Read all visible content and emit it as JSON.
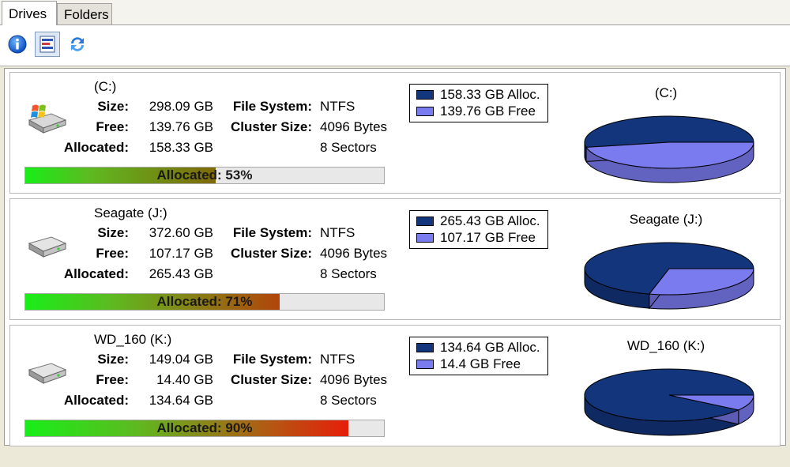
{
  "tabs": [
    {
      "label": "Drives",
      "active": true
    },
    {
      "label": "Folders",
      "active": false
    }
  ],
  "toolbar": {
    "buttons": [
      {
        "icon": "info-icon"
      },
      {
        "icon": "details-view-icon",
        "pressed": true
      },
      {
        "icon": "refresh-icon"
      }
    ]
  },
  "labels": {
    "size": "Size:",
    "free": "Free:",
    "allocated": "Allocated:",
    "file_system": "File System:",
    "cluster_size": "Cluster Size:"
  },
  "colors": {
    "allocated": "#13357b",
    "free": "#7b7bf0"
  },
  "drives": [
    {
      "name": "(C:)",
      "icon": "windows-drive-icon",
      "size": "298.09 GB",
      "free": "139.76 GB",
      "allocated": "158.33 GB",
      "file_system": "NTFS",
      "cluster_size": "4096 Bytes",
      "sectors": "8 Sectors",
      "allocated_pct": 53,
      "bar_label": "Allocated: 53%",
      "legend_alloc": "158.33 GB Alloc.",
      "legend_free": "139.76 GB Free",
      "pie_title": "(C:)"
    },
    {
      "name": "Seagate (J:)",
      "icon": "hard-drive-icon",
      "size": "372.60 GB",
      "free": "107.17 GB",
      "allocated": "265.43 GB",
      "file_system": "NTFS",
      "cluster_size": "4096 Bytes",
      "sectors": "8 Sectors",
      "allocated_pct": 71,
      "bar_label": "Allocated: 71%",
      "legend_alloc": "265.43 GB Alloc.",
      "legend_free": "107.17 GB Free",
      "pie_title": "Seagate (J:)"
    },
    {
      "name": "WD_160 (K:)",
      "icon": "hard-drive-icon",
      "size": "149.04 GB",
      "free": "14.40 GB",
      "allocated": "134.64 GB",
      "file_system": "NTFS",
      "cluster_size": "4096 Bytes",
      "sectors": "8 Sectors",
      "allocated_pct": 90,
      "bar_label": "Allocated: 90%",
      "legend_alloc": "134.64 GB Alloc.",
      "legend_free": "14.4 GB Free",
      "pie_title": "WD_160 (K:)"
    }
  ]
}
